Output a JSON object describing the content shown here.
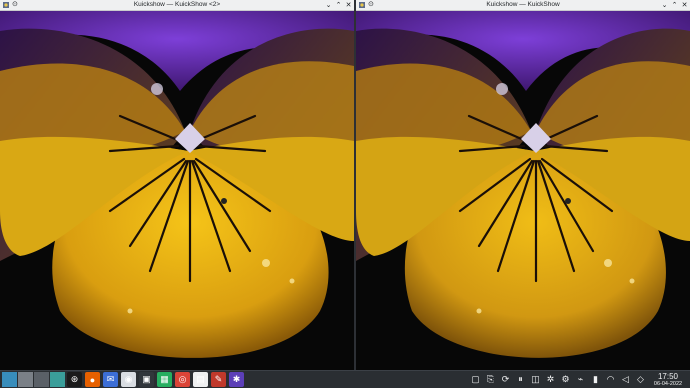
{
  "windows": [
    {
      "title": "Kuickshow — KuickShow <2>"
    },
    {
      "title": "Kuickshow — KuickShow"
    }
  ],
  "titlebar_controls": {
    "pin": "⊙",
    "minimize": "⌄",
    "maximize": "⌃",
    "close": "✕"
  },
  "taskbar": {
    "tasks": [
      {
        "icon": "konsole-icon",
        "glyph": "⊛",
        "color": "#1a1a1a"
      },
      {
        "icon": "firefox-icon",
        "glyph": "●",
        "color": "#e66000"
      },
      {
        "icon": "mail-client-icon",
        "glyph": "✉",
        "color": "#3c6ed6"
      },
      {
        "icon": "messenger-icon",
        "glyph": "◉",
        "color": "#d9dde2"
      },
      {
        "icon": "terminal-icon",
        "glyph": "▣",
        "color": "#31363b"
      },
      {
        "icon": "image-viewer-icon",
        "glyph": "▦",
        "color": "#27ae60"
      },
      {
        "icon": "chrome-icon",
        "glyph": "◎",
        "color": "#db4437"
      },
      {
        "icon": "document-viewer-icon",
        "glyph": "▤",
        "color": "#eff0f1"
      },
      {
        "icon": "paint-icon",
        "glyph": "✎",
        "color": "#c0392b"
      },
      {
        "icon": "settings-icon",
        "glyph": "✱",
        "color": "#5c3fb8"
      }
    ],
    "tray": [
      {
        "icon": "show-desktop-icon",
        "glyph": "▢"
      },
      {
        "icon": "clipboard-icon",
        "glyph": "⎘"
      },
      {
        "icon": "updates-icon",
        "glyph": "⟳"
      },
      {
        "icon": "pause-icon",
        "glyph": "⏸"
      },
      {
        "icon": "media-icon",
        "glyph": "◫"
      },
      {
        "icon": "slack-icon",
        "glyph": "✲"
      },
      {
        "icon": "tweak-icon",
        "glyph": "⚙"
      },
      {
        "icon": "usb-icon",
        "glyph": "⌁"
      },
      {
        "icon": "battery-icon",
        "glyph": "▮"
      },
      {
        "icon": "wifi-icon",
        "glyph": "◠"
      },
      {
        "icon": "volume-icon",
        "glyph": "◁"
      },
      {
        "icon": "notifications-icon",
        "glyph": "◇"
      }
    ],
    "clock": {
      "time": "17:50",
      "date": "06-04-2022"
    }
  }
}
